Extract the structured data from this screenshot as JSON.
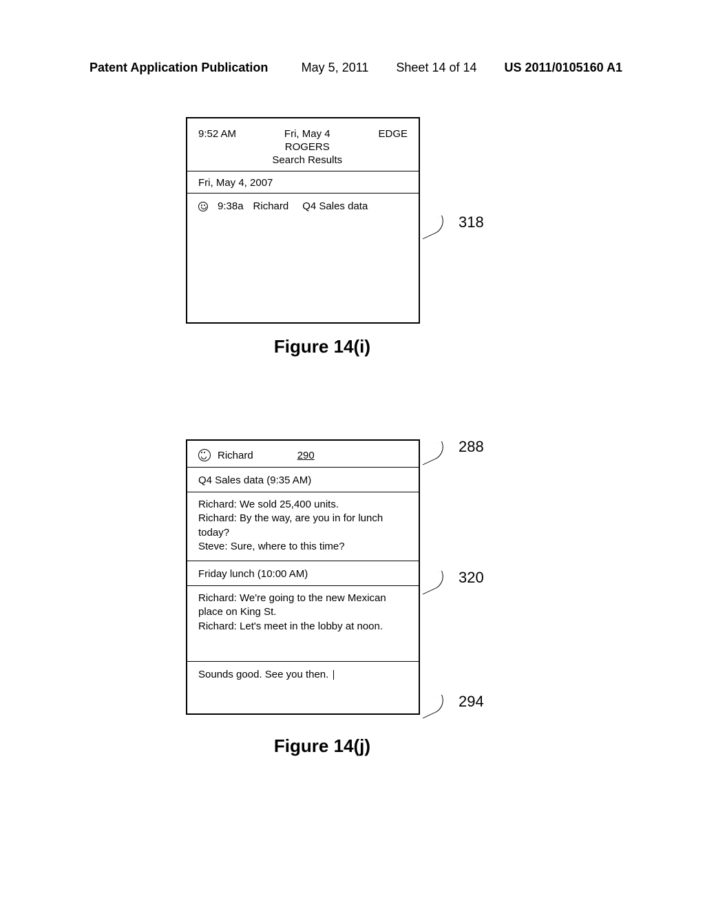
{
  "page_header": {
    "publication_label": "Patent Application Publication",
    "date": "May 5, 2011",
    "sheet": "Sheet 14 of 14",
    "pub_number": "US 2011/0105160 A1"
  },
  "figure_i": {
    "status": {
      "time": "9:52 AM",
      "date": "Fri, May 4",
      "carrier": "ROGERS",
      "screen_title": "Search Results",
      "network": "EDGE"
    },
    "date_header": "Fri, May 4, 2007",
    "result": {
      "time": "9:38a",
      "sender": "Richard",
      "subject": "Q4 Sales data"
    },
    "callout_ref": "318",
    "caption": "Figure 14(i)"
  },
  "figure_j": {
    "contact": {
      "name": "Richard",
      "ref_num": "290"
    },
    "thread1": {
      "title": "Q4 Sales data (9:35 AM)",
      "line1": "Richard: We sold 25,400 units.",
      "line2": "Richard: By the way, are you in for lunch today?",
      "line3": "Steve: Sure, where to this time?"
    },
    "thread2": {
      "title": "Friday lunch (10:00 AM)",
      "line1": "Richard: We're going to the new Mexican place on King St.",
      "line2": "Richard: Let's meet in the lobby at noon."
    },
    "input_text": "Sounds good. See you then.",
    "callout_288": "288",
    "callout_320": "320",
    "callout_294": "294",
    "caption": "Figure 14(j)"
  }
}
